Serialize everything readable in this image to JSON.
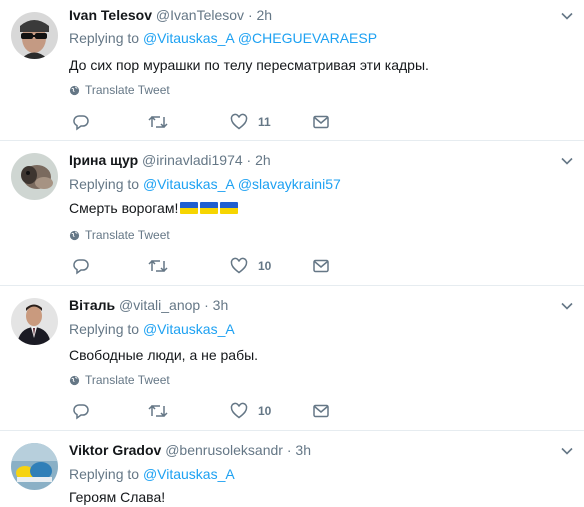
{
  "tweets": [
    {
      "name": "Ivan Telesov",
      "handle": "@IvanTelesov",
      "dot": "·",
      "time": "2h",
      "replying_label": "Replying to",
      "mention1": "@Vitauskas_A",
      "mention2": "@CHEGUEVARAESP",
      "text": "До сих пор мурашки по телу пересматривая эти кадры.",
      "translate": "Translate Tweet",
      "likes": "11"
    },
    {
      "name": "Ірина щур",
      "handle": "@irinavladi1974",
      "dot": "·",
      "time": "2h",
      "replying_label": "Replying to",
      "mention1": "@Vitauskas_A",
      "mention2": "@slavaykraini57",
      "text": "Смерть ворогам!",
      "translate": "Translate Tweet",
      "likes": "10"
    },
    {
      "name": "Віталь",
      "handle": "@vitali_anop",
      "dot": "·",
      "time": "3h",
      "replying_label": "Replying to",
      "mention1": "@Vitauskas_A",
      "text": "Свободные люди, а не рабы.",
      "translate": "Translate Tweet",
      "likes": "10"
    },
    {
      "name": "Viktor Gradov",
      "handle": "@benrusoleksandr",
      "dot": "·",
      "time": "3h",
      "replying_label": "Replying to",
      "mention1": "@Vitauskas_A",
      "text": "Героям Слава!"
    }
  ],
  "icons": {
    "caret": "chevron-down-icon",
    "globe": "globe-icon",
    "reply": "reply-icon",
    "retweet": "retweet-icon",
    "like": "heart-icon",
    "dm": "envelope-icon"
  },
  "colors": {
    "link": "#1da1f2",
    "muted": "#657786",
    "divider": "#e6ecf0"
  }
}
